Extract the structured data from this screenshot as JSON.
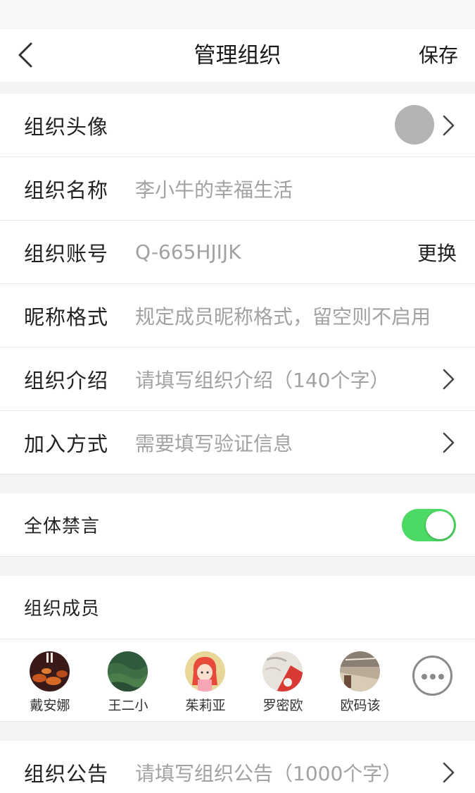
{
  "nav": {
    "title": "管理组织",
    "save_label": "保存"
  },
  "rows": {
    "avatar": {
      "label": "组织头像"
    },
    "name": {
      "label": "组织名称",
      "value": "李小牛的幸福生活"
    },
    "account": {
      "label": "组织账号",
      "value": "Q-665HJIJK",
      "action": "更换"
    },
    "nickname": {
      "label": "昵称格式",
      "placeholder": "规定成员昵称格式，留空则不启用"
    },
    "intro": {
      "label": "组织介绍",
      "placeholder": "请填写组织介绍（140个字）"
    },
    "join": {
      "label": "加入方式",
      "value": "需要填写验证信息"
    },
    "mute_all": {
      "label": "全体禁言",
      "enabled": true
    },
    "members_header": {
      "label": "组织成员"
    },
    "notice": {
      "label": "组织公告",
      "placeholder": "请填写组织公告（1000个字）"
    }
  },
  "members": [
    {
      "name": "戴安娜"
    },
    {
      "name": "王二小"
    },
    {
      "name": "茱莉亚"
    },
    {
      "name": "罗密欧"
    },
    {
      "name": "欧码该"
    }
  ],
  "colors": {
    "toggle_on": "#4cd964",
    "placeholder": "#a2a2a2",
    "page_bg": "#f4f4f4"
  },
  "icons": {
    "back": "chevron-left-icon",
    "disclosure": "chevron-right-icon",
    "more": "more-dots-icon"
  }
}
